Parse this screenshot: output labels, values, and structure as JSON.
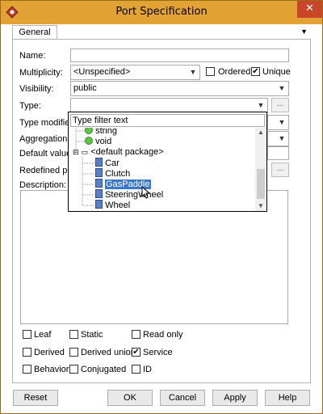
{
  "window": {
    "title": "Port Specification",
    "close_glyph": "✕",
    "app_icon": "app-logo-icon",
    "accent": "#e3a234"
  },
  "tabs": {
    "general": "General",
    "menu_glyph": "▼"
  },
  "form": {
    "name_label": "Name:",
    "name_value": "",
    "multiplicity_label": "Multiplicity:",
    "multiplicity_value": "<Unspecified>",
    "ordered_label": "Ordered",
    "ordered_checked": false,
    "unique_label": "Unique",
    "unique_checked": true,
    "visibility_label": "Visibility:",
    "visibility_value": "public",
    "type_label": "Type:",
    "type_value": "",
    "type_modifier_label": "Type modifier:",
    "aggregation_label": "Aggregation:",
    "default_value_label": "Default value:",
    "redefined_port_label": "Redefined port:",
    "description_label": "Description:",
    "dots": "..."
  },
  "popup": {
    "filter_placeholder": "Type filter text",
    "items": [
      {
        "label": "string",
        "icon": "primitive-type-icon"
      },
      {
        "label": "void",
        "icon": "primitive-type-icon"
      },
      {
        "label": "<default package>",
        "icon": "package-icon"
      },
      {
        "label": "Car",
        "icon": "class-icon"
      },
      {
        "label": "Clutch",
        "icon": "class-icon"
      },
      {
        "label": "GasPaddle",
        "icon": "class-icon",
        "selected": true
      },
      {
        "label": "SteeringWheel",
        "icon": "class-icon"
      },
      {
        "label": "Wheel",
        "icon": "class-icon"
      }
    ]
  },
  "checkboxes": [
    {
      "label": "Leaf",
      "checked": false
    },
    {
      "label": "Static",
      "checked": false
    },
    {
      "label": "Read only",
      "checked": false
    },
    {
      "label": "Derived",
      "checked": false
    },
    {
      "label": "Derived union",
      "checked": false
    },
    {
      "label": "Service",
      "checked": true
    },
    {
      "label": "Behavior",
      "checked": false
    },
    {
      "label": "Conjugated",
      "checked": false
    },
    {
      "label": "ID",
      "checked": false
    }
  ],
  "buttons": {
    "reset": "Reset",
    "ok": "OK",
    "cancel": "Cancel",
    "apply": "Apply",
    "help": "Help"
  },
  "check_glyph": "✔"
}
